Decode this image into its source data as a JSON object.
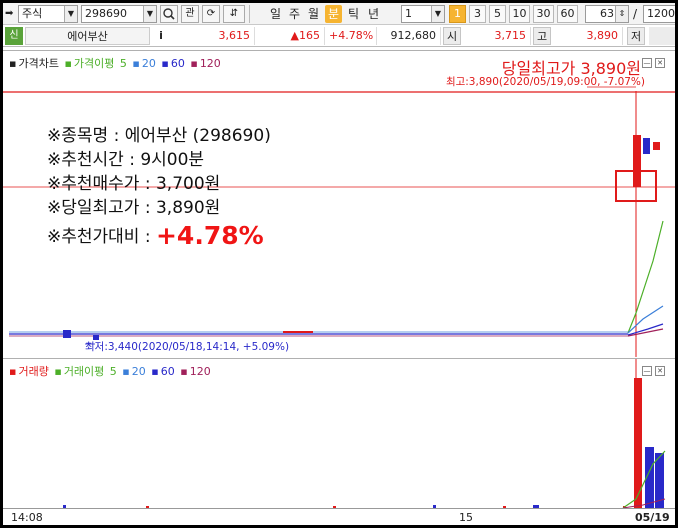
{
  "toolbar": {
    "market": "주식",
    "code": "298690",
    "tab_related": "관",
    "periods": [
      "일",
      "주",
      "월",
      "분",
      "틱",
      "년"
    ],
    "active_period": "분",
    "period_value": "1",
    "minute_label": "1",
    "minute_buttons": [
      "3",
      "5",
      "10",
      "30",
      "60"
    ],
    "count_value": "63",
    "slash": "/",
    "total_value": "1200"
  },
  "quote": {
    "badge": "신",
    "name": "에어부산",
    "info_icon": "i",
    "price": "3,615",
    "change": "▲165",
    "change_pct": "+4.78%",
    "volume": "912,680",
    "open_label": "시",
    "open": "3,715",
    "high_label": "고",
    "high": "3,890",
    "low_label": "저"
  },
  "price_panel": {
    "legend_price": "가격차트",
    "legend_ma": "가격이평",
    "ma_periods": [
      "5",
      "20",
      "60",
      "120"
    ],
    "high_title": "당일최고가 3,890원",
    "high_sub": "최고:3,890(2020/05/19,09:00,  -7.07%)",
    "low_sub": "최저:3,440(2020/05/18,14:14,  +5.09%)"
  },
  "annotation": {
    "line1": "※종목명 : 에어부산 (298690)",
    "line2": "※추천시간 : 9시00분",
    "line3": "※추천매수가 : 3,700원",
    "line4": "※당일최고가 : 3,890원",
    "line5_prefix": "※추천가대비 : ",
    "line5_value": "+4.78%"
  },
  "volume_panel": {
    "legend_volume": "거래량",
    "legend_ma": "거래이평",
    "ma_periods": [
      "5",
      "20",
      "60",
      "120"
    ]
  },
  "xaxis": {
    "left": "14:08",
    "mid": "15",
    "right": "05/19"
  },
  "colors": {
    "up": "#e01a1a",
    "down": "#2929c9",
    "accent": "#f6b431",
    "ma5": "#4caf28",
    "ma20": "#3b7fd9",
    "ma60": "#2929c9",
    "ma120": "#a0205a"
  }
}
